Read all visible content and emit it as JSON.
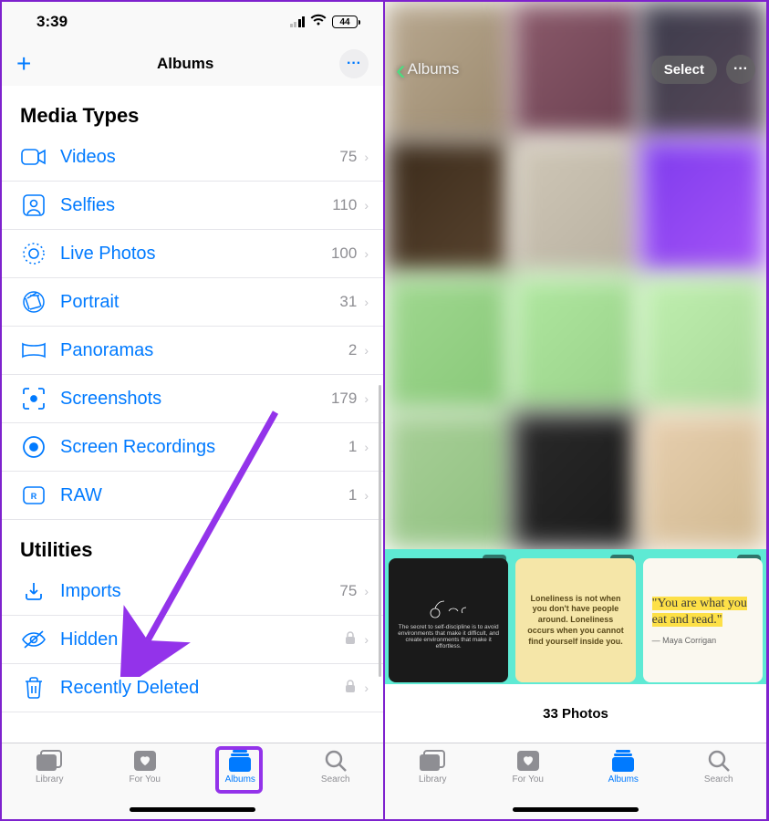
{
  "status": {
    "time": "3:39",
    "battery": "44"
  },
  "left": {
    "title": "Albums",
    "section1": "Media Types",
    "section2": "Utilities",
    "rows": {
      "videos": {
        "label": "Videos",
        "count": "75"
      },
      "selfies": {
        "label": "Selfies",
        "count": "110"
      },
      "live": {
        "label": "Live Photos",
        "count": "100"
      },
      "portrait": {
        "label": "Portrait",
        "count": "31"
      },
      "pano": {
        "label": "Panoramas",
        "count": "2"
      },
      "shots": {
        "label": "Screenshots",
        "count": "179"
      },
      "rec": {
        "label": "Screen Recordings",
        "count": "1"
      },
      "raw": {
        "label": "RAW",
        "count": "1"
      },
      "imports": {
        "label": "Imports",
        "count": "75"
      },
      "hidden": {
        "label": "Hidden"
      },
      "deleted": {
        "label": "Recently Deleted"
      }
    }
  },
  "tabs": {
    "library": "Library",
    "foryou": "For You",
    "albums": "Albums",
    "search": "Search"
  },
  "right": {
    "back": "Albums",
    "select": "Select",
    "count": "33 Photos",
    "quotes": {
      "q1": "The secret to self-discipline is to avoid environments that make it difficult, and create environments that make it effortless.",
      "q2": "Loneliness is not when you don't have people around. Loneliness occurs when you cannot find yourself inside you.",
      "q3": "\"You are what you eat and read.\"",
      "q3author": "— Maya Corrigan"
    }
  }
}
